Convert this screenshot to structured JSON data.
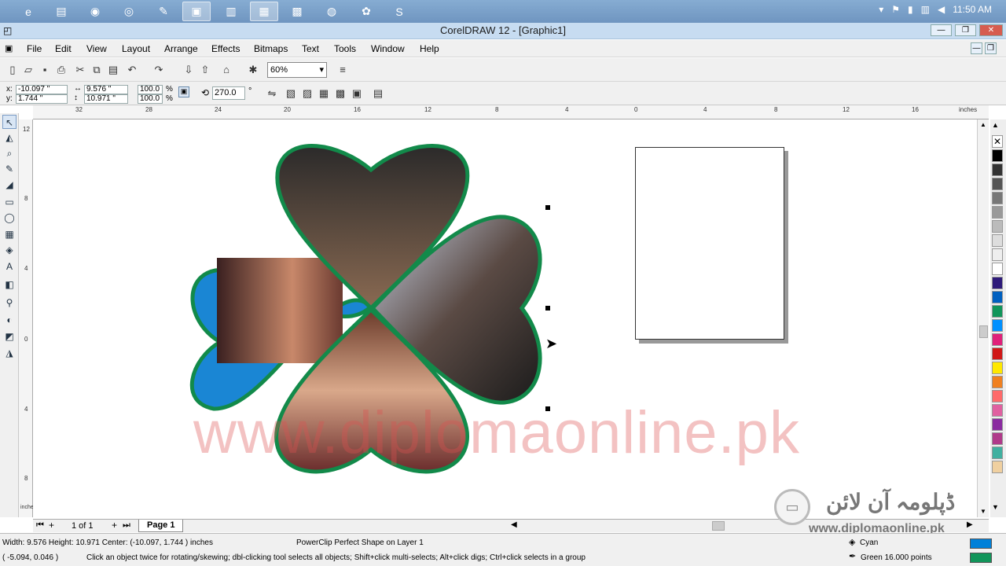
{
  "taskbar": {
    "apps": [
      "ie-icon",
      "folder-icon",
      "firefox-icon",
      "chrome-icon",
      "coreldraw-icon",
      "coreldraw-doc-icon",
      "winword-icon",
      "excel-icon",
      "grid-icon",
      "network-icon",
      "paint-icon",
      "skype-icon"
    ],
    "clock": "11:50 AM"
  },
  "window": {
    "title": "CorelDRAW 12 - [Graphic1]"
  },
  "menu": [
    "File",
    "Edit",
    "View",
    "Layout",
    "Arrange",
    "Effects",
    "Bitmaps",
    "Text",
    "Tools",
    "Window",
    "Help"
  ],
  "toolbar": {
    "zoom": "60%"
  },
  "properties": {
    "x": "-10.097 \"",
    "y": "1.744 \"",
    "width": "9.576 \"",
    "height": "10.971 \"",
    "scale_x": "100.0",
    "scale_y": "100.0",
    "pct1": "%",
    "pct2": "%",
    "rotation": "270.0",
    "deg": "°",
    "xlabel": "x:",
    "ylabel": "y:"
  },
  "ruler": {
    "unit": "inches",
    "top_ticks": [
      "32",
      "28",
      "24",
      "20",
      "16",
      "12",
      "8",
      "4",
      "0",
      "4",
      "8",
      "12",
      "16"
    ],
    "left_ticks": [
      "12",
      "8",
      "4",
      "0",
      "4",
      "8"
    ],
    "left_unit": "inches"
  },
  "canvas": {
    "watermark": "www.diplomaonline.pk"
  },
  "pages": {
    "counter": "1 of 1",
    "tab": "Page 1"
  },
  "status": {
    "dimensions": "Width: 9.576  Height: 10.971  Center: (-10.097, 1.744 )  inches",
    "object": "PowerClip Perfect Shape on Layer 1",
    "cursor": "( -5.094, 0.046 )",
    "hint": "Click an object twice for rotating/skewing; dbl-clicking tool selects all objects; Shift+click multi-selects; Alt+click digs; Ctrl+click selects in a group",
    "fill_name": "Cyan",
    "outline": "Green  16.000 points"
  },
  "logo": {
    "urdu": "ڈپلومہ آن لائن",
    "url": "www.diplomaonline.pk"
  },
  "colors": {
    "fill": "#0080d8",
    "outline": "#11955a",
    "clover_outline": "#128a4a"
  }
}
